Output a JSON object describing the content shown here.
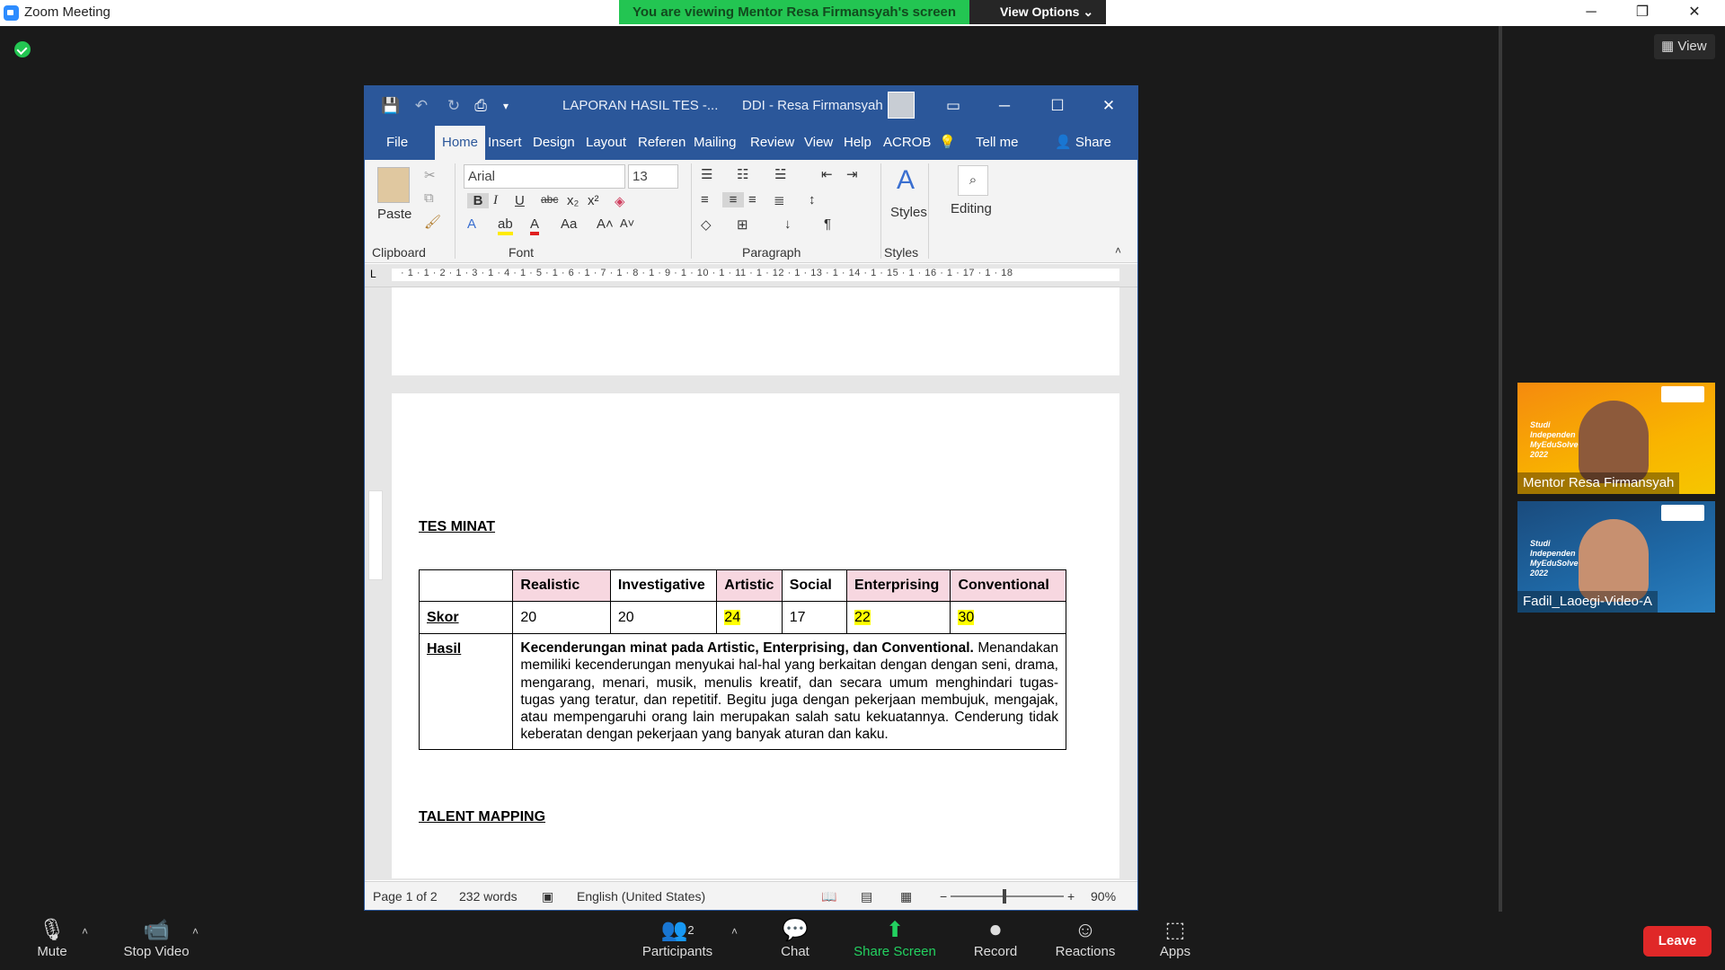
{
  "window": {
    "title": "Zoom Meeting"
  },
  "banner": {
    "viewing": "You are viewing Mentor Resa Firmansyah's screen",
    "view_options": "View Options"
  },
  "sidebar": {
    "view_label": "View",
    "participants": [
      {
        "name": "Mentor Resa Firmansyah",
        "banner": "Studi Independen MyEduSolve 2022"
      },
      {
        "name": "Fadil_Laoegi-Video-A",
        "banner": "Studi Independen MyEduSolve 2022"
      }
    ]
  },
  "word": {
    "doc_title": "LAPORAN HASIL TES -...",
    "user": "DDI - Resa Firmansyah",
    "tabs": [
      "File",
      "Home",
      "Insert",
      "Design",
      "Layout",
      "Referen",
      "Mailing",
      "Review",
      "View",
      "Help",
      "ACROB",
      "Tell me",
      "Share"
    ],
    "ribbon": {
      "paste": "Paste",
      "font_name": "Arial",
      "font_size": "13",
      "styles": "Styles",
      "editing": "Editing",
      "groups": [
        "Clipboard",
        "Font",
        "Paragraph",
        "Styles"
      ]
    },
    "ruler": "· 1 · 1 · 2 · 1 · 3 · 1 · 4 · 1 · 5 · 1 · 6 · 1 · 7 · 1 · 8 · 1 · 9 · 1 · 10 · 1 · 11 · 1 · 12 · 1 · 13 · 1 · 14 · 1 · 15 · 1 · 16 · 1 · 17 · 1 · 18",
    "document": {
      "heading1": "TES MINAT",
      "table": {
        "headers": [
          "",
          "Realistic",
          "Investigative",
          "Artistic",
          "Social",
          "Enterprising",
          "Conventional"
        ],
        "skor_label": "Skor",
        "scores": [
          "20",
          "20",
          "24",
          "17",
          "22",
          "30"
        ],
        "hasil_label": "Hasil",
        "hasil_bold": "Kecenderungan minat pada Artistic, Enterprising, dan Conventional.",
        "hasil_text": "Menandakan memiliki kecenderungan menyukai hal-hal yang berkaitan dengan dengan seni, drama, mengarang, menari, musik, menulis kreatif, dan secara umum menghindari tugas-tugas yang teratur, dan repetitif. Begitu juga dengan pekerjaan membujuk, mengajak, atau mempengaruhi orang lain merupakan salah satu kekuatannya. Cenderung tidak keberatan dengan pekerjaan yang banyak aturan dan kaku."
      },
      "heading2": "TALENT MAPPING"
    },
    "status": {
      "page": "Page 1 of 2",
      "words": "232 words",
      "language": "English (United States)",
      "zoom": "90%"
    }
  },
  "toolbar": {
    "mute": "Mute",
    "stop_video": "Stop Video",
    "participants": "Participants",
    "participants_count": "2",
    "chat": "Chat",
    "share_screen": "Share Screen",
    "record": "Record",
    "reactions": "Reactions",
    "apps": "Apps",
    "leave": "Leave"
  }
}
